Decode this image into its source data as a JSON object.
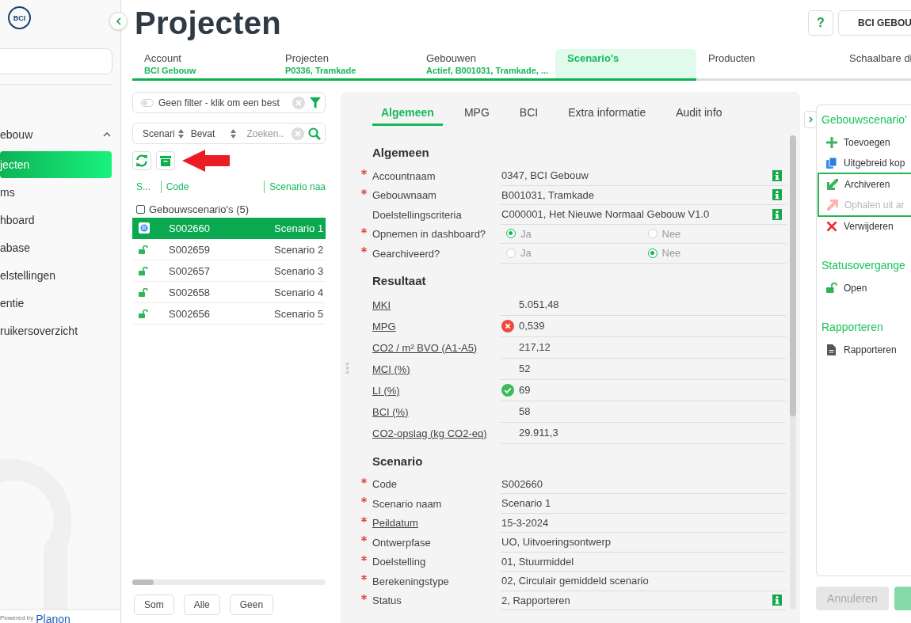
{
  "sidebar": {
    "logo": "BCI",
    "section": {
      "label": "ebouw",
      "expanded": true
    },
    "items": [
      {
        "label": "jecten",
        "selected": true
      },
      {
        "label": "ms",
        "selected": false
      },
      {
        "label": "hboard",
        "selected": false
      },
      {
        "label": "abase",
        "selected": false
      },
      {
        "label": "elstellingen",
        "selected": false
      },
      {
        "label": "entie",
        "selected": false
      },
      {
        "label": "ruikersoverzicht",
        "selected": false
      }
    ],
    "footer": {
      "prefix": "Powered by",
      "brand": "Planon"
    }
  },
  "header": {
    "title": "Projecten",
    "help": "?",
    "account": "BCI GEBOU"
  },
  "breadcrumb_tabs": [
    {
      "label": "Account",
      "value": "BCI Gebouw",
      "selected": false
    },
    {
      "label": "Projecten",
      "value": "P0336, Tramkade",
      "selected": false
    },
    {
      "label": "Gebouwen",
      "value": "Actief, B001031, Tramkade, ...",
      "selected": false
    },
    {
      "label": "Scenario's",
      "selected": true
    },
    {
      "label": "Producten",
      "selected": false
    },
    {
      "label": "Schaalbare di",
      "selected": false
    }
  ],
  "list": {
    "filter": {
      "on": false,
      "text": "Geen filter - klik om een best"
    },
    "search": {
      "field": "Scenari",
      "operator": "Bevat",
      "placeholder": "Zoeken.."
    },
    "columns": [
      "S...",
      "Code",
      "Scenario naa"
    ],
    "group": {
      "label": "Gebouwscenario's (5)",
      "checked": false
    },
    "rows": [
      {
        "kind": "report",
        "code": "S002660",
        "name": "Scenario 1",
        "selected": true
      },
      {
        "kind": "open",
        "code": "S002659",
        "name": "Scenario 2",
        "selected": false
      },
      {
        "kind": "open",
        "code": "S002657",
        "name": "Scenario 3",
        "selected": false
      },
      {
        "kind": "open",
        "code": "S002658",
        "name": "Scenario 4",
        "selected": false
      },
      {
        "kind": "open",
        "code": "S002656",
        "name": "Scenario 5",
        "selected": false
      }
    ],
    "buttons": [
      "Som",
      "Alle",
      "Geen"
    ]
  },
  "details": {
    "tabs": [
      {
        "label": "Algemeen",
        "selected": true
      },
      {
        "label": "MPG",
        "selected": false
      },
      {
        "label": "BCI",
        "selected": false
      },
      {
        "label": "Extra informatie",
        "selected": false
      },
      {
        "label": "Audit info",
        "selected": false
      }
    ],
    "sections": [
      {
        "title": "Algemeen",
        "fields": [
          {
            "kind": "text",
            "label": "Accountnaam",
            "required": true,
            "link": false,
            "value": "0347, BCI Gebouw",
            "info": true
          },
          {
            "kind": "text",
            "label": "Gebouwnaam",
            "required": true,
            "link": false,
            "value": "B001031, Tramkade",
            "info": true
          },
          {
            "kind": "text",
            "label": "Doelstellingscriteria",
            "required": false,
            "link": false,
            "value": "C000001, Het Nieuwe Normaal Gebouw V1.0",
            "info": true
          },
          {
            "kind": "radio",
            "label": "Opnemen in dashboard?",
            "required": true,
            "link": false,
            "options": [
              {
                "label": "Ja",
                "selected": true
              },
              {
                "label": "Nee",
                "selected": false
              }
            ]
          },
          {
            "kind": "radio",
            "label": "Gearchiveerd?",
            "required": true,
            "link": false,
            "options": [
              {
                "label": "Ja",
                "selected": false
              },
              {
                "label": "Nee",
                "selected": true
              }
            ]
          }
        ]
      },
      {
        "title": "Resultaat",
        "fields": [
          {
            "kind": "result",
            "label": "MKI",
            "required": false,
            "link": true,
            "value": "5.051,48"
          },
          {
            "kind": "result",
            "label": "MPG",
            "required": false,
            "link": true,
            "value": "0,539",
            "passed": false
          },
          {
            "kind": "result",
            "label": "CO2 / m² BVO (A1-A5)",
            "required": false,
            "link": true,
            "value": "217,12"
          },
          {
            "kind": "result",
            "label": "MCI (%)",
            "required": false,
            "link": true,
            "value": "52"
          },
          {
            "kind": "result",
            "label": "LI (%)",
            "required": false,
            "link": true,
            "value": "69",
            "passed": true
          },
          {
            "kind": "result",
            "label": "BCI (%)",
            "required": false,
            "link": true,
            "value": "58"
          },
          {
            "kind": "result",
            "label": "CO2-opslag (kg CO2-eq)",
            "required": false,
            "link": true,
            "value": "29.911,3"
          }
        ]
      },
      {
        "title": "Scenario",
        "fields": [
          {
            "kind": "text",
            "label": "Code",
            "required": true,
            "link": false,
            "value": "S002660",
            "info": false
          },
          {
            "kind": "text",
            "label": "Scenario naam",
            "required": true,
            "link": false,
            "value": "Scenario 1",
            "info": false
          },
          {
            "kind": "text",
            "label": "Peildatum",
            "required": true,
            "link": true,
            "value": "15-3-2024",
            "info": false
          },
          {
            "kind": "text",
            "label": "Ontwerpfase",
            "required": true,
            "link": false,
            "value": "UO, Uitvoeringsontwerp",
            "info": false
          },
          {
            "kind": "text",
            "label": "Doelstelling",
            "required": true,
            "link": false,
            "value": "01, Stuurmiddel",
            "info": false
          },
          {
            "kind": "text",
            "label": "Berekeningstype",
            "required": true,
            "link": false,
            "value": "02, Circulair gemiddeld scenario",
            "info": false
          },
          {
            "kind": "text",
            "label": "Status",
            "required": true,
            "link": false,
            "value": "2, Rapporteren",
            "info": true
          }
        ]
      }
    ]
  },
  "actions": {
    "groups": [
      {
        "title": "Gebouwscenario'",
        "items": [
          {
            "kind": "plus",
            "label": "Toevoegen",
            "disabled": false,
            "highlighted": false
          },
          {
            "kind": "copy",
            "label": "Uitgebreid kop",
            "disabled": false,
            "highlighted": false
          },
          {
            "kind": "archive",
            "label": "Archiveren",
            "disabled": false,
            "highlighted": true
          },
          {
            "kind": "restore",
            "label": "Ophalen uit ar",
            "disabled": true,
            "highlighted": true
          },
          {
            "kind": "delete",
            "label": "Verwijderen",
            "disabled": false,
            "highlighted": false
          }
        ]
      },
      {
        "title": "Statusovergange",
        "items": [
          {
            "kind": "unlock",
            "label": "Open",
            "disabled": false,
            "highlighted": false
          }
        ]
      },
      {
        "title": "Rapporteren",
        "items": [
          {
            "kind": "document",
            "label": "Rapporteren",
            "disabled": false,
            "highlighted": false
          }
        ]
      }
    ]
  },
  "footer_buttons": [
    {
      "label": "Annuleren",
      "disabled": true
    }
  ]
}
